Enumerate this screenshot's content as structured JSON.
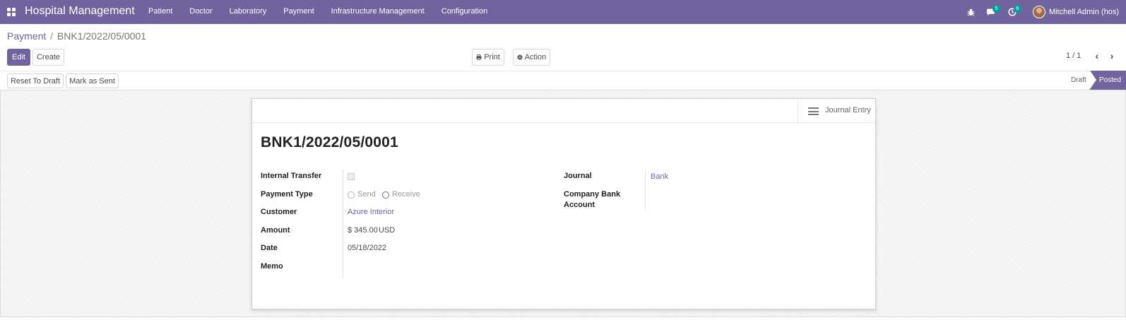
{
  "app": {
    "title": "Hospital Management",
    "menu": [
      "Patient",
      "Doctor",
      "Laboratory",
      "Payment",
      "Infrastructure Management",
      "Configuration"
    ]
  },
  "systray": {
    "messages_count": "5",
    "activities_count": "6",
    "user_name": "Mitchell Admin (hos)"
  },
  "breadcrumb": {
    "parent": "Payment",
    "separator": "/",
    "current": "BNK1/2022/05/0001"
  },
  "buttons": {
    "edit": "Edit",
    "create": "Create",
    "print": "Print",
    "action": "Action",
    "reset_to_draft": "Reset To Draft",
    "mark_as_sent": "Mark as Sent"
  },
  "pager": {
    "value": "1 / 1"
  },
  "status": {
    "draft": "Draft",
    "posted": "Posted",
    "current": "Posted"
  },
  "smart_button": {
    "label": "Journal Entry"
  },
  "record": {
    "name": "BNK1/2022/05/0001",
    "fields_left": {
      "internal_transfer": {
        "label": "Internal Transfer",
        "checked": false
      },
      "payment_type": {
        "label": "Payment Type",
        "options": [
          "Send",
          "Receive"
        ],
        "selected": "Receive"
      },
      "customer": {
        "label": "Customer",
        "value": "Azure Interior"
      },
      "amount": {
        "label": "Amount",
        "value": "$ 345.00",
        "currency": "USD"
      },
      "date": {
        "label": "Date",
        "value": "05/18/2022"
      },
      "memo": {
        "label": "Memo",
        "value": ""
      }
    },
    "fields_right": {
      "journal": {
        "label": "Journal",
        "value": "Bank"
      },
      "company_bank_account": {
        "label_line1": "Company Bank",
        "label_line2": "Account",
        "value": ""
      }
    }
  },
  "colors": {
    "brand": "#71639e",
    "badge": "#00a09d"
  }
}
